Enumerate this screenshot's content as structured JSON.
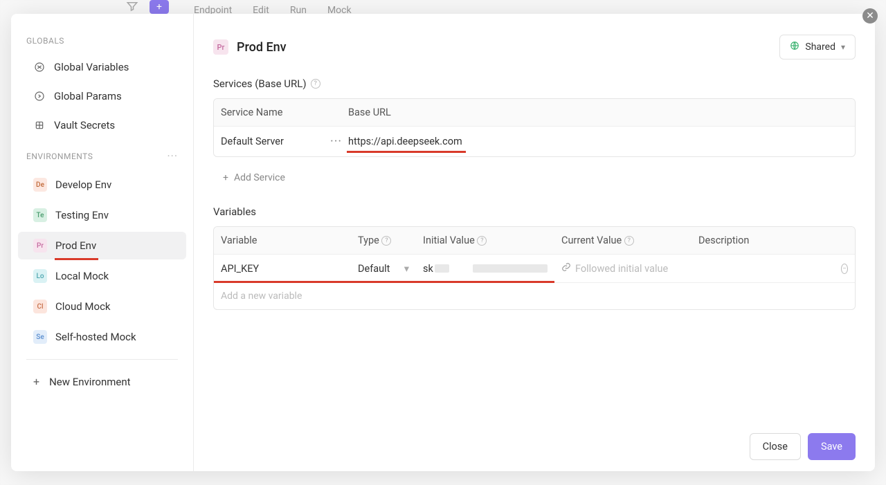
{
  "bg": {
    "tabs": [
      "Endpoint",
      "Edit",
      "Run",
      "Mock"
    ]
  },
  "sidebar": {
    "globals_label": "GLOBALS",
    "globals": [
      {
        "label": "Global Variables",
        "icon": "variable"
      },
      {
        "label": "Global Params",
        "icon": "params"
      },
      {
        "label": "Vault Secrets",
        "icon": "vault"
      }
    ],
    "environments_label": "ENVIRONMENTS",
    "environments": [
      {
        "badge": "De",
        "label": "Develop Env",
        "cls": "badge-de"
      },
      {
        "badge": "Te",
        "label": "Testing Env",
        "cls": "badge-te"
      },
      {
        "badge": "Pr",
        "label": "Prod Env",
        "cls": "badge-pr",
        "active": true,
        "underlined": true
      },
      {
        "badge": "Lo",
        "label": "Local Mock",
        "cls": "badge-lo"
      },
      {
        "badge": "Cl",
        "label": "Cloud Mock",
        "cls": "badge-cl"
      },
      {
        "badge": "Se",
        "label": "Self-hosted Mock",
        "cls": "badge-se"
      }
    ],
    "new_env": "New Environment"
  },
  "header": {
    "badge": "Pr",
    "title": "Prod Env",
    "shared": "Shared"
  },
  "services": {
    "title": "Services (Base URL)",
    "cols": {
      "name": "Service Name",
      "url": "Base URL"
    },
    "rows": [
      {
        "name": "Default Server",
        "url": "https://api.deepseek.com"
      }
    ],
    "add": "Add Service"
  },
  "variables": {
    "title": "Variables",
    "cols": {
      "variable": "Variable",
      "type": "Type",
      "initial": "Initial Value",
      "current": "Current Value",
      "desc": "Description"
    },
    "rows": [
      {
        "variable": "API_KEY",
        "type": "Default",
        "initial_prefix": "sk",
        "current_placeholder": "Followed initial value"
      }
    ],
    "add_placeholder": "Add a new variable"
  },
  "footer": {
    "close": "Close",
    "save": "Save"
  }
}
